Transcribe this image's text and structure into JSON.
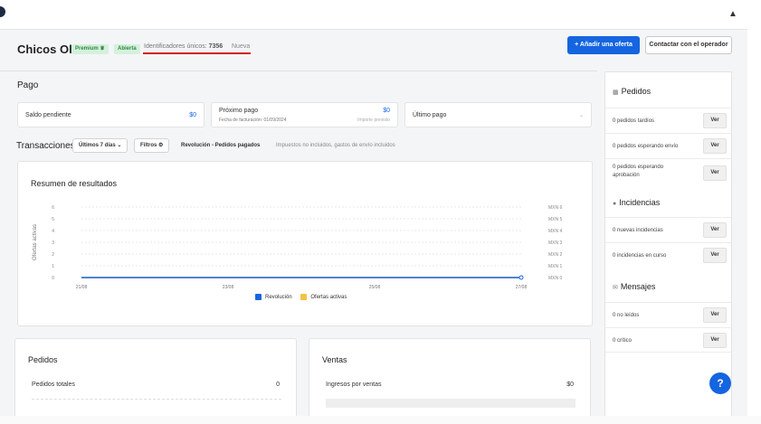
{
  "topbar": {
    "user_icon": "person-icon"
  },
  "header": {
    "store_name": "Chicos Olé",
    "badge_premium": "Premium ♛",
    "badge_status": "Abierta",
    "unique_ids_label": "Identificadores únicos:",
    "unique_ids_value": "7356",
    "nueva": "Nueva",
    "add_offer_button": "+ Añadir una oferta",
    "contact_button": "Contactar con el operador"
  },
  "pago": {
    "title": "Pago",
    "saldo_label": "Saldo pendiente",
    "saldo_value": "$0",
    "proximo_label": "Próximo pago",
    "proximo_value": "$0",
    "fecha_label": "Fecha de facturación: 01/09/2024",
    "importe_label": "Importe previsto",
    "ultimo_label": "Último pago"
  },
  "transacciones": {
    "title": "Transacciones",
    "range_select": "Últimos 7 días ⌄",
    "filters_button": "Filtros ⚙",
    "metric_label": "Revolución - Pedidos pagados",
    "metric_note": "Impuestos no incluidos, gastos de envío incluidos"
  },
  "chart_data": {
    "type": "line",
    "title": "Resumen de resultados",
    "ylabel": "Ofertas activas",
    "x": [
      "21/08",
      "22/08",
      "23/08",
      "24/08",
      "25/08",
      "26/08",
      "27/08"
    ],
    "xticks": [
      "21/08",
      "23/08",
      "25/08",
      "27/08"
    ],
    "ylim": [
      0,
      6
    ],
    "yticks": [
      "0",
      "1",
      "2",
      "3",
      "4",
      "5",
      "6"
    ],
    "y2ticks": [
      "MXN 0",
      "MXN 1",
      "MXN 2",
      "MXN 3",
      "MXN 4",
      "MXN 5",
      "MXN 6"
    ],
    "series": [
      {
        "name": "Revolución",
        "color": "#1565e0",
        "values": [
          0,
          0,
          0,
          0,
          0,
          0,
          0
        ]
      },
      {
        "name": "Ofertas activas",
        "color": "#f3c246",
        "values": [
          0,
          0,
          0,
          0,
          0,
          0,
          0
        ]
      }
    ],
    "legend": "bottom-center",
    "grid": true
  },
  "sidebar": {
    "pedidos_title": "Pedidos",
    "pedidos_icon": "chart-icon",
    "pedidos_rows": [
      {
        "label": "0 pedidos tardíos",
        "button": "Ver"
      },
      {
        "label": "0 pedidos esperando envío",
        "button": "Ver"
      },
      {
        "label": "0 pedidos esperando aprobación",
        "button": "Ver"
      }
    ],
    "incidencias_title": "Incidencias",
    "incidencias_icon": "info-icon",
    "incidencias_rows": [
      {
        "label": "0 nuevas incidencias",
        "button": "Ver"
      },
      {
        "label": "0 incidencias en curso",
        "button": "Ver"
      }
    ],
    "mensajes_title": "Mensajes",
    "mensajes_icon": "envelope-icon",
    "mensajes_rows": [
      {
        "label": "0 no leídos",
        "button": "Ver"
      },
      {
        "label": "0 crítico",
        "button": "Ver"
      }
    ]
  },
  "bottom": {
    "pedidos_title": "Pedidos",
    "pedidos_totales_label": "Pedidos totales",
    "pedidos_totales_value": "0",
    "ventas_title": "Ventas",
    "ingresos_label": "Ingresos por ventas",
    "ingresos_value": "$0"
  },
  "help_icon": "question-icon"
}
